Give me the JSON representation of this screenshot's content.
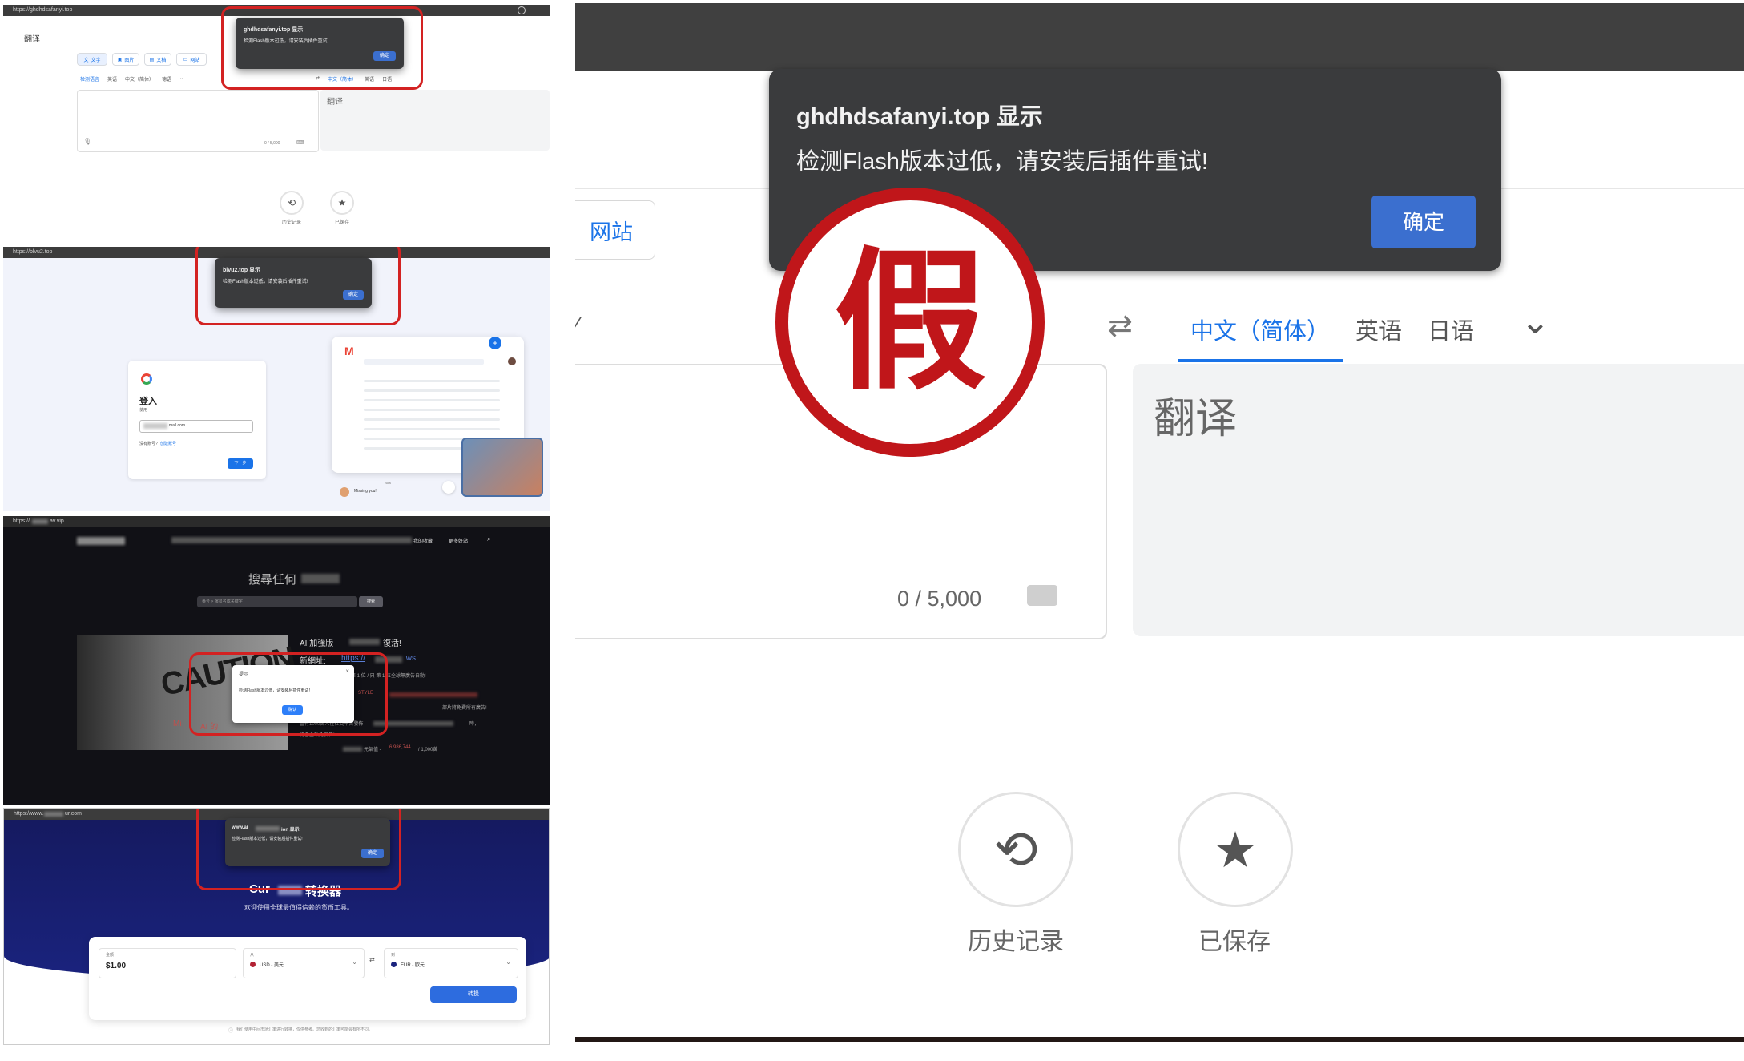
{
  "panel1": {
    "url": "https://ghdhdsafanyi.top",
    "app_title": "翻译",
    "tabs": [
      "文字",
      "图片",
      "文档",
      "网站"
    ],
    "source_langs": [
      "检测语言",
      "英语",
      "中文（简体）",
      "德语"
    ],
    "target_langs": [
      "中文（简体）",
      "英语",
      "日语"
    ],
    "counter": "0 / 5,000",
    "output_placeholder": "翻译",
    "history_label": "历史记录",
    "saved_label": "已保存",
    "dialog": {
      "title": "ghdhdsafanyi.top 显示",
      "message": "检测Flash版本过低，请安装后插件重试!",
      "ok": "确定"
    }
  },
  "panel2": {
    "url": "https://blvu2.top",
    "signin_title": "登入",
    "signin_sub": "使用",
    "email_value": "mail.com",
    "no_account": "没有账号?",
    "create_link": "创建账号",
    "next_btn": "下一步",
    "chat_msg": "Missing you!",
    "chat_time": "Now",
    "dialog": {
      "title": "blvu2.top 显示",
      "message": "检测Flash版本过低，请安装后插件重试!",
      "ok": "确定"
    }
  },
  "panel3": {
    "url": "https://",
    "url_suffix": "av.vip",
    "nav_items": [
      "我的收藏",
      "更多好站"
    ],
    "search_heading": "搜尋任何",
    "search_placeholder": "番号 > 演员名或关键字",
    "search_btn": "搜索",
    "promo_title": "AI 加強版",
    "promo_title_end": "復活!",
    "new_url_label": "新網址:",
    "new_url": "https://",
    "new_url_end": ".ws",
    "line1": "第 1 位 / 只 第 1 位全球無廣告自動!",
    "line2": "S I STYLE",
    "line3": "部片將免費所有廣告!",
    "line4": "當有1000萬人在社交平台發佈",
    "line4_end": "時，",
    "line5": "將會全站免廣告!",
    "counter_label": "元氣值 -",
    "counter_value": "6,986,744",
    "counter_total": "/ 1,000萬",
    "caution_text": "CAUTION",
    "image_caption": "Mi",
    "image_caption_end": "AI 的",
    "dialog": {
      "title": "提示",
      "message": "检测Flash版本过低，请安装后插件重试！",
      "ok": "确认",
      "close": "×"
    }
  },
  "panel4": {
    "url": "https://www.",
    "url_end": "ur.com",
    "heading": "Cur",
    "heading_end": "转换器",
    "subheading": "欢迎使用全球最值得信赖的货币工具。",
    "amount_label": "金额",
    "amount_value": "$1.00",
    "from_label": "从",
    "from_value": "USD - 美元",
    "to_label": "到",
    "to_value": "EUR - 欧元",
    "swap_icon": "⇄",
    "convert_btn": "转换",
    "footnote": "我们使用中间市场汇率进行转换，仅供参考。您收到的汇率可能会有所不同。",
    "dialog": {
      "title": "www.ai",
      "title_end": "ion 显示",
      "message": "检测Flash版本过低，请安装后插件重试!",
      "ok": "确定"
    }
  },
  "zoom": {
    "tab_website": "网站",
    "target_langs": [
      "中文（简体）",
      "英语",
      "日语"
    ],
    "counter": "0 / 5,000",
    "output_placeholder": "翻译",
    "history_label": "历史记录",
    "saved_label": "已保存",
    "stamp_text": "假",
    "dialog": {
      "title": "ghdhdsafanyi.top 显示",
      "message": "检测Flash版本过低，请安装后插件重试!",
      "ok": "确定"
    }
  },
  "colors": {
    "accent": "#1a73e8",
    "dialog_bg": "#3a3b3d",
    "ok_button": "#3b6fcf",
    "stamp_red": "#c0161a",
    "dark_bg": "#111116",
    "navy": "#1a237e"
  }
}
